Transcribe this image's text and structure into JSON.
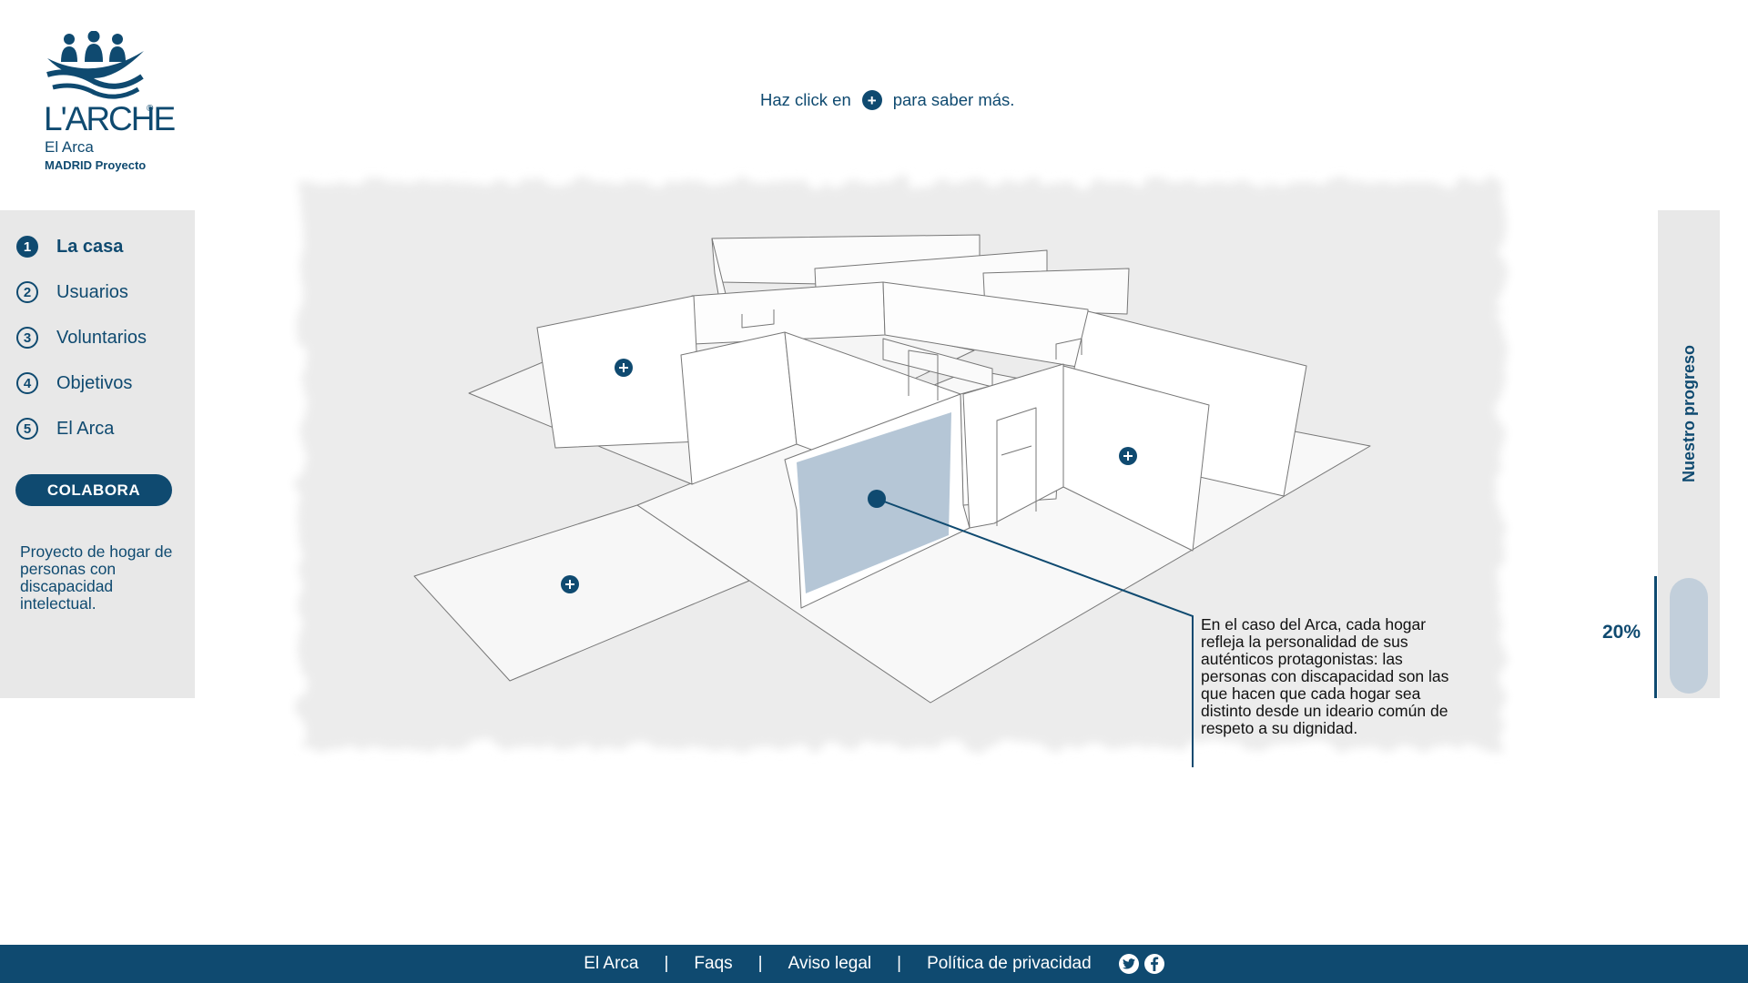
{
  "logo": {
    "brand": "L'ARCHE",
    "registered": "®",
    "line1": "El Arca",
    "line2": "MADRID Proyecto"
  },
  "hint": {
    "before": "Haz click en",
    "after": "para saber más.",
    "icon": "plus-circle-icon"
  },
  "sidebar": {
    "items": [
      {
        "number": "1",
        "label": "La casa",
        "active": true
      },
      {
        "number": "2",
        "label": "Usuarios",
        "active": false
      },
      {
        "number": "3",
        "label": "Voluntarios",
        "active": false
      },
      {
        "number": "4",
        "label": "Objetivos",
        "active": false
      },
      {
        "number": "5",
        "label": "El Arca",
        "active": false
      }
    ],
    "cta_label": "COLABORA",
    "description": "Proyecto de hogar de personas con discapacidad intelectual."
  },
  "callout": {
    "text": "En el caso del Arca, cada hogar refleja la personalidad de sus auténticos protagonistas: las personas con discapacidad son las que hacen que cada hogar sea distinto desde un ideario común de respeto a su dignidad."
  },
  "progress": {
    "title": "Nuestro progreso",
    "percent_label": "20%",
    "value": 0.2
  },
  "footer": {
    "links": [
      "El Arca",
      "Faqs",
      "Aviso legal",
      "Política de privacidad"
    ],
    "social": [
      "twitter-icon",
      "facebook-icon"
    ]
  },
  "colors": {
    "primary": "#0f4a70",
    "panel": "#e8e8e8",
    "highlight": "#b5c6d6",
    "progress_fill": "#c2cfdb"
  }
}
